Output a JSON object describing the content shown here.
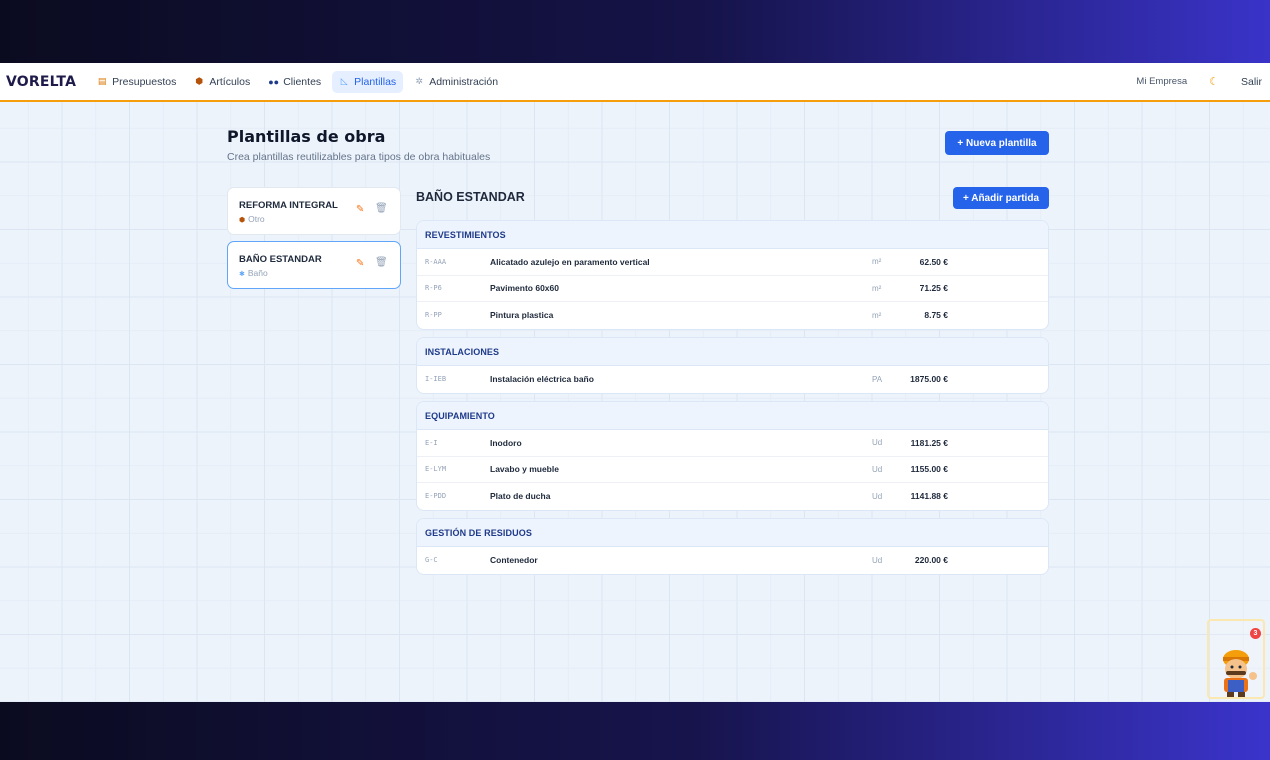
{
  "app": {
    "logo": "VORELTA"
  },
  "nav": {
    "items": [
      {
        "label": "Presupuestos",
        "icon": "clipboard-icon"
      },
      {
        "label": "Artículos",
        "icon": "box-icon"
      },
      {
        "label": "Clientes",
        "icon": "users-icon"
      },
      {
        "label": "Plantillas",
        "icon": "ruler-icon",
        "active": true
      },
      {
        "label": "Administración",
        "icon": "gear-icon"
      }
    ],
    "company": "Mi Empresa",
    "logout": "Salir"
  },
  "page": {
    "title": "Plantillas de obra",
    "subtitle": "Crea plantillas reutilizables para tipos de obra habituales",
    "new_button": "+ Nueva plantilla"
  },
  "templates": [
    {
      "name": "REFORMA INTEGRAL",
      "category": "Otro"
    },
    {
      "name": "BAÑO ESTANDAR",
      "category": "Baño",
      "selected": true
    }
  ],
  "detail": {
    "title": "BAÑO ESTANDAR",
    "add_button": "+ Añadir partida",
    "sections": [
      {
        "name": "REVESTIMIENTOS",
        "rows": [
          {
            "code": "R-AAA",
            "desc": "Alicatado azulejo en paramento vertical",
            "unit": "m²",
            "price": "62.50 €"
          },
          {
            "code": "R-P6",
            "desc": "Pavimento 60x60",
            "unit": "m²",
            "price": "71.25 €"
          },
          {
            "code": "R-PP",
            "desc": "Pintura plastica",
            "unit": "m²",
            "price": "8.75 €"
          }
        ]
      },
      {
        "name": "INSTALACIONES",
        "rows": [
          {
            "code": "I-IEB",
            "desc": "Instalación eléctrica baño",
            "unit": "PA",
            "price": "1875.00 €"
          }
        ]
      },
      {
        "name": "EQUIPAMIENTO",
        "rows": [
          {
            "code": "E-I",
            "desc": "Inodoro",
            "unit": "Ud",
            "price": "1181.25 €"
          },
          {
            "code": "E-LYM",
            "desc": "Lavabo y mueble",
            "unit": "Ud",
            "price": "1155.00 €"
          },
          {
            "code": "E-PDD",
            "desc": "Plato de ducha",
            "unit": "Ud",
            "price": "1141.88 €"
          }
        ]
      },
      {
        "name": "GESTIÓN DE RESIDUOS",
        "rows": [
          {
            "code": "G-C",
            "desc": "Contenedor",
            "unit": "Ud",
            "price": "220.00 €"
          }
        ]
      }
    ]
  },
  "assistant": {
    "notifications": "3"
  }
}
